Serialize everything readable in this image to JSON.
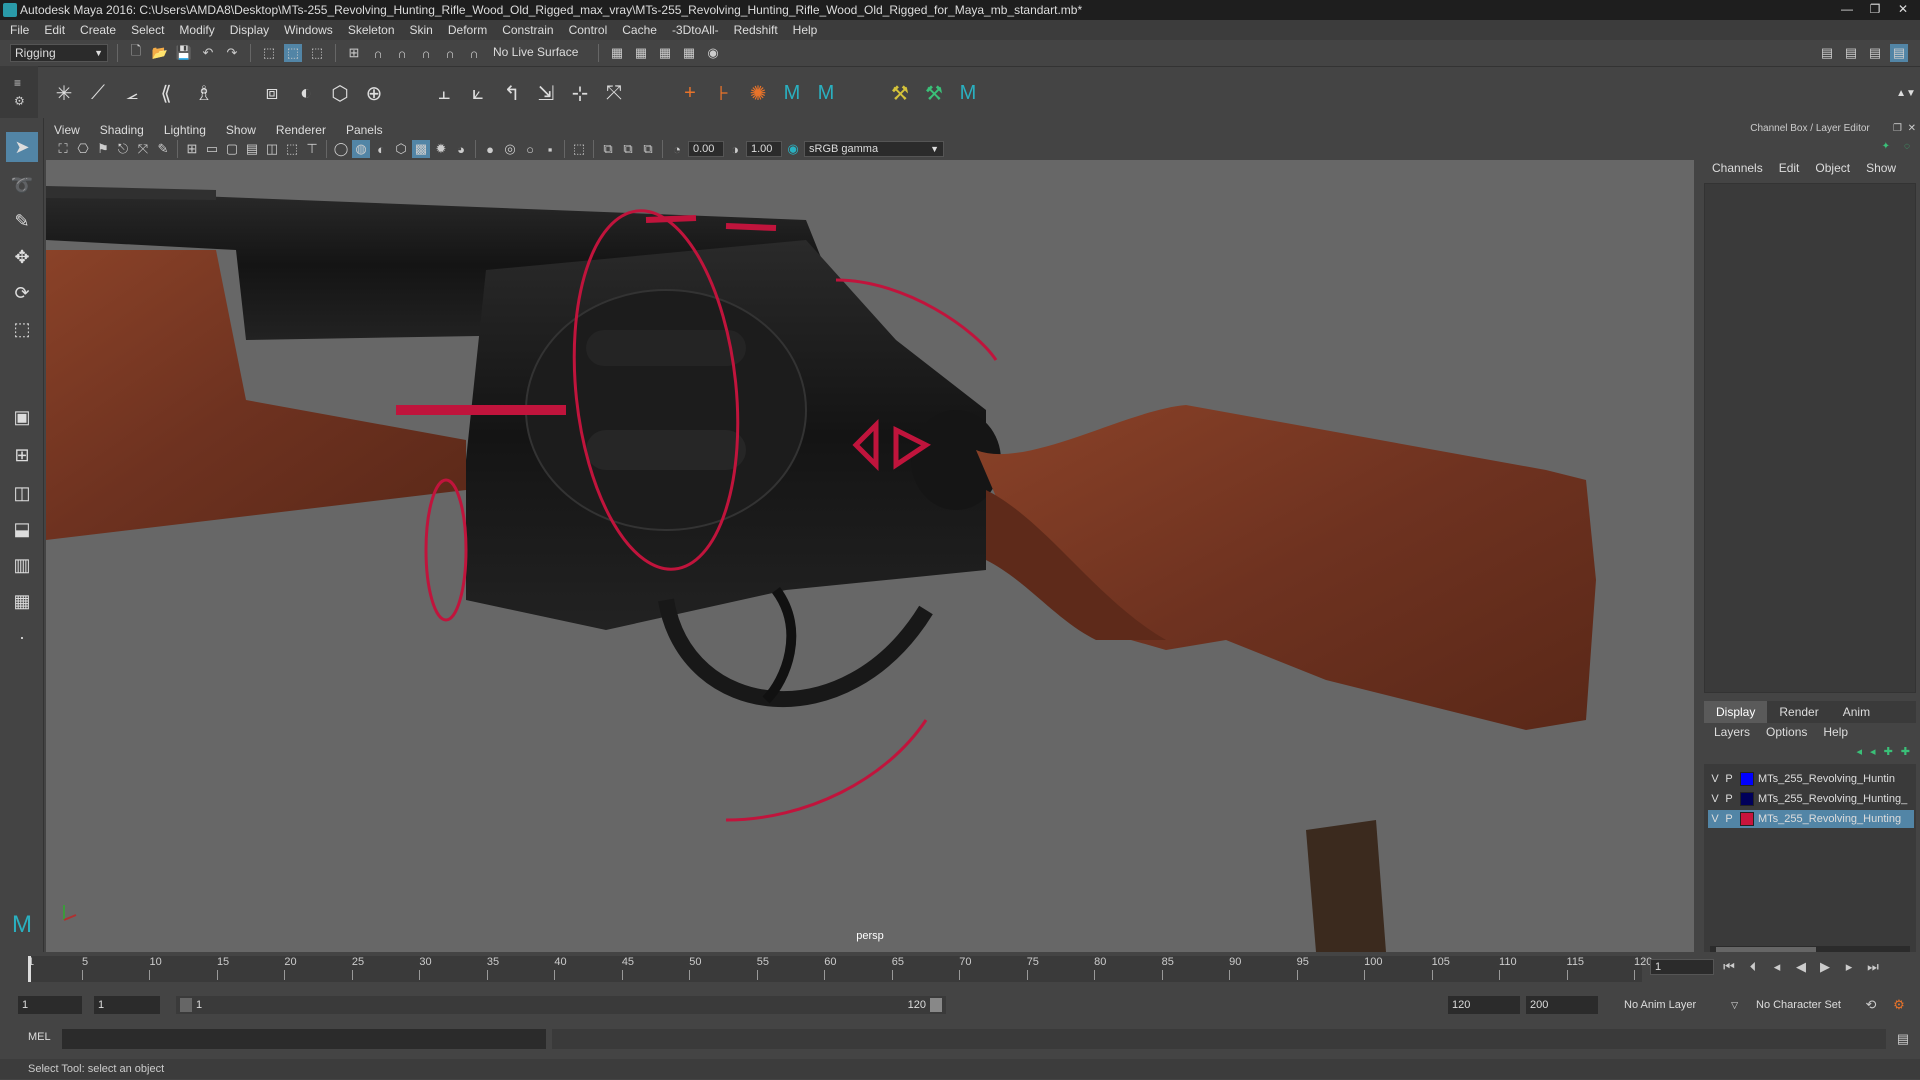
{
  "window": {
    "title": "Autodesk Maya 2016: C:\\Users\\AMDA8\\Desktop\\MTs-255_Revolving_Hunting_Rifle_Wood_Old_Rigged_max_vray\\MTs-255_Revolving_Hunting_Rifle_Wood_Old_Rigged_for_Maya_mb_standart.mb*",
    "controls": [
      "—",
      "❐",
      "✕"
    ]
  },
  "menubar": [
    "File",
    "Edit",
    "Create",
    "Select",
    "Modify",
    "Display",
    "Windows",
    "Skeleton",
    "Skin",
    "Deform",
    "Constrain",
    "Control",
    "Cache",
    "-3DtoAll-",
    "Redshift",
    "Help"
  ],
  "status_line": {
    "mode": "Rigging",
    "live_surface": "No Live Surface"
  },
  "viewport": {
    "menu": [
      "View",
      "Shading",
      "Lighting",
      "Show",
      "Renderer",
      "Panels"
    ],
    "near_value": "0.00",
    "far_value": "1.00",
    "color_space": "sRGB gamma",
    "camera": "persp",
    "colors": {
      "background": "#676767",
      "wood": "#7a3a22",
      "metal": "#1a1a1a",
      "control": "#c0143c"
    }
  },
  "channel_box": {
    "title": "Channel Box / Layer Editor",
    "menu": [
      "Channels",
      "Edit",
      "Object",
      "Show"
    ]
  },
  "layer_editor": {
    "tabs": [
      "Display",
      "Render",
      "Anim"
    ],
    "active_tab": "Display",
    "menu": [
      "Layers",
      "Options",
      "Help"
    ],
    "layers": [
      {
        "v": "V",
        "p": "P",
        "name": "MTs_255_Revolving_Huntin",
        "color": "#0000ff",
        "selected": false
      },
      {
        "v": "V",
        "p": "P",
        "name": "MTs_255_Revolving_Hunting_",
        "color": "#00005a",
        "selected": false
      },
      {
        "v": "V",
        "p": "P",
        "name": "MTs_255_Revolving_Hunting",
        "color": "#c8143c",
        "selected": true
      }
    ]
  },
  "timeline": {
    "ticks": [
      "1",
      "5",
      "10",
      "15",
      "20",
      "25",
      "30",
      "35",
      "40",
      "45",
      "50",
      "55",
      "60",
      "65",
      "70",
      "75",
      "80",
      "85",
      "90",
      "95",
      "100",
      "105",
      "110",
      "115",
      "120"
    ],
    "current_frame": "1"
  },
  "range": {
    "start": "1",
    "playback_start": "1",
    "slider_start": "1",
    "slider_end": "120",
    "playback_end": "120",
    "end": "200",
    "anim_layer": "No Anim Layer",
    "character_set": "No Character Set"
  },
  "command": {
    "label": "MEL"
  },
  "help_line": "Select Tool: select an object"
}
